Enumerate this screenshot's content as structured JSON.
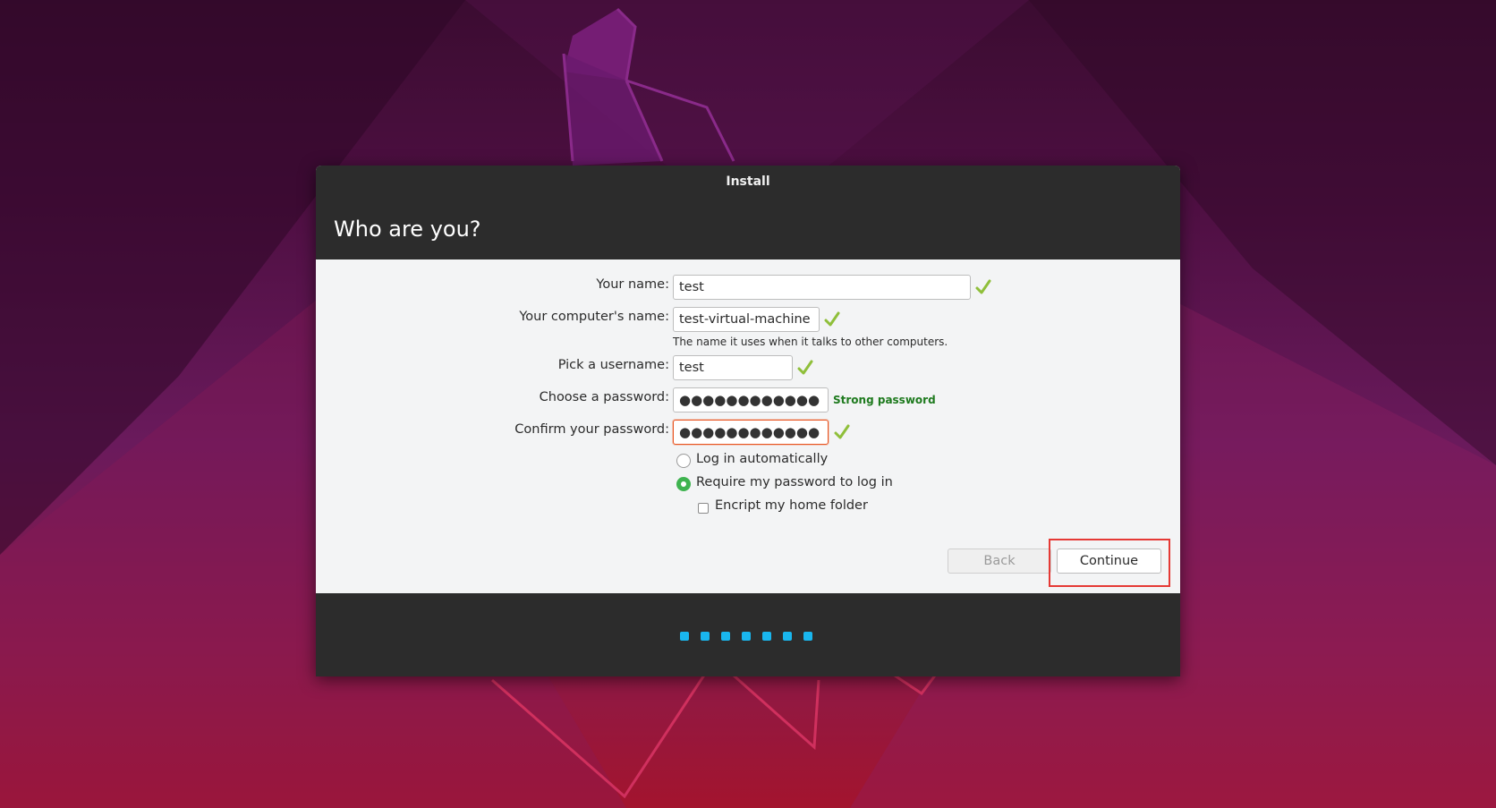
{
  "window": {
    "title": "Install",
    "page_title": "Who are you?"
  },
  "form": {
    "your_name": {
      "label": "Your name:",
      "value": "test"
    },
    "computer_name": {
      "label": "Your computer's name:",
      "value": "test-virtual-machine",
      "hint": "The name it uses when it talks to other computers."
    },
    "username": {
      "label": "Pick a username:",
      "value": "test"
    },
    "password": {
      "label": "Choose a password:",
      "value": "●●●●●●●●●●●●",
      "strength": "Strong password"
    },
    "confirm_password": {
      "label": "Confirm your password:",
      "value": "●●●●●●●●●●●●"
    },
    "login_options": [
      {
        "label": "Log in automatically",
        "selected": false
      },
      {
        "label": "Require my password to log in",
        "selected": true
      }
    ],
    "encrypt_home": {
      "label": "Encript my home folder",
      "checked": false
    }
  },
  "buttons": {
    "back": "Back",
    "continue": "Continue"
  },
  "progress": {
    "steps_total": 7
  },
  "colors": {
    "accent_orange": "#e95420",
    "check_green": "#8fbf3a",
    "strong_green": "#1e7a1e",
    "step_blue": "#19b6ee",
    "highlight_red": "#e53935"
  },
  "icons": {
    "valid": "checkmark-icon"
  }
}
